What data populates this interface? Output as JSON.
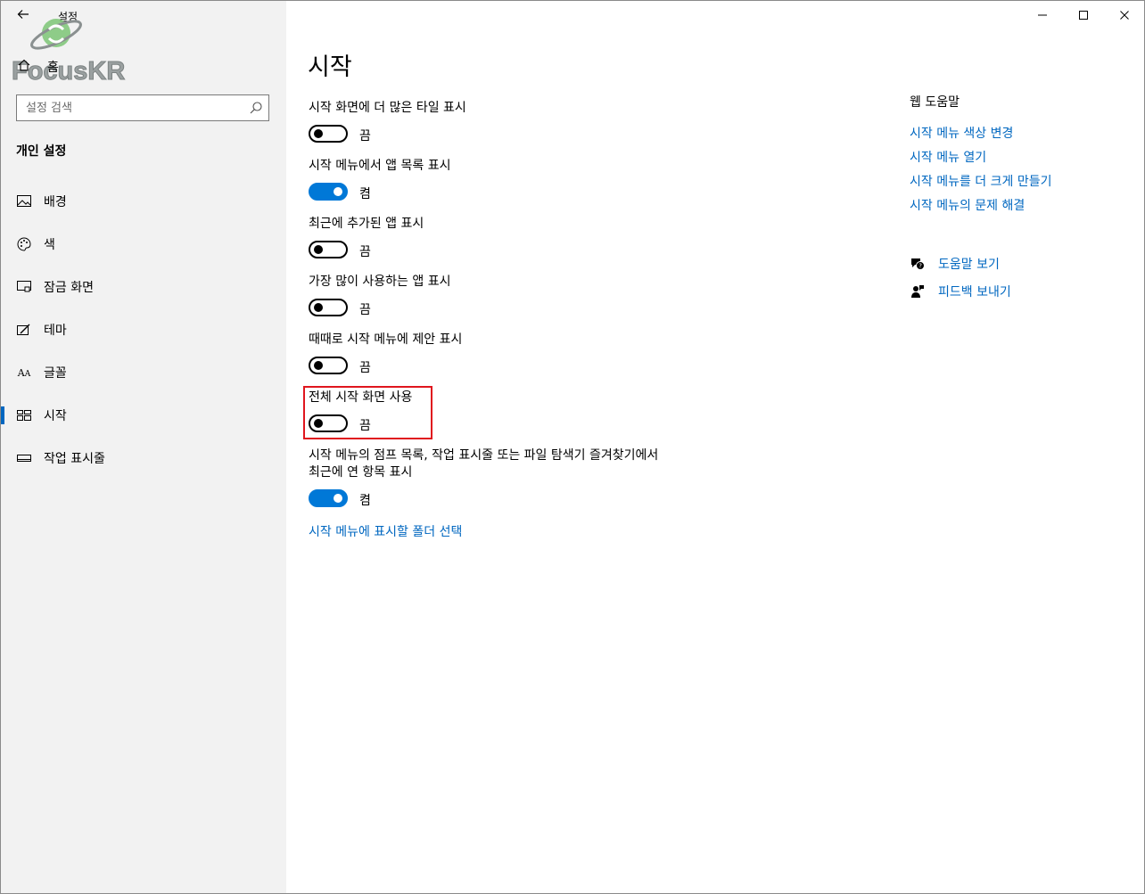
{
  "window": {
    "app_title": "설정",
    "watermark": "FocusKR"
  },
  "sidebar": {
    "home_label": "홈",
    "search": {
      "placeholder": "설정 검색",
      "value": ""
    },
    "section_title": "개인 설정",
    "items": [
      {
        "label": "배경",
        "icon": "picture-icon"
      },
      {
        "label": "색",
        "icon": "palette-icon"
      },
      {
        "label": "잠금 화면",
        "icon": "lock-screen-icon"
      },
      {
        "label": "테마",
        "icon": "theme-brush-icon"
      },
      {
        "label": "글꼴",
        "icon": "font-icon"
      },
      {
        "label": "시작",
        "icon": "start-tiles-icon",
        "active": true
      },
      {
        "label": "작업 표시줄",
        "icon": "taskbar-icon"
      }
    ]
  },
  "main": {
    "title": "시작",
    "settings": [
      {
        "label": "시작 화면에 더 많은 타일 표시",
        "state": "끔",
        "on": false
      },
      {
        "label": "시작 메뉴에서 앱 목록 표시",
        "state": "켬",
        "on": true
      },
      {
        "label": "최근에 추가된 앱 표시",
        "state": "끔",
        "on": false
      },
      {
        "label": "가장 많이 사용하는 앱 표시",
        "state": "끔",
        "on": false
      },
      {
        "label": "때때로 시작 메뉴에 제안 표시",
        "state": "끔",
        "on": false
      },
      {
        "label": "전체 시작 화면 사용",
        "state": "끔",
        "on": false
      },
      {
        "label_line1": "시작 메뉴의 점프 목록, 작업 표시줄 또는 파일 탐색기 즐겨찾기에서",
        "label_line2": "최근에 연 항목 표시",
        "state": "켬",
        "on": true
      }
    ],
    "folder_link": "시작 메뉴에 표시할 폴더 선택"
  },
  "help": {
    "title": "웹 도움말",
    "links": [
      "시작 메뉴 색상 변경",
      "시작 메뉴 열기",
      "시작 메뉴를 더 크게 만들기",
      "시작 메뉴의 문제 해결"
    ],
    "actions": [
      {
        "label": "도움말 보기",
        "icon": "help-chat-icon"
      },
      {
        "label": "피드백 보내기",
        "icon": "feedback-icon"
      }
    ]
  },
  "colors": {
    "accent": "#0078d7",
    "link": "#0067c0",
    "highlight": "#e0161e",
    "sidebar_bg": "#f2f2f2"
  }
}
